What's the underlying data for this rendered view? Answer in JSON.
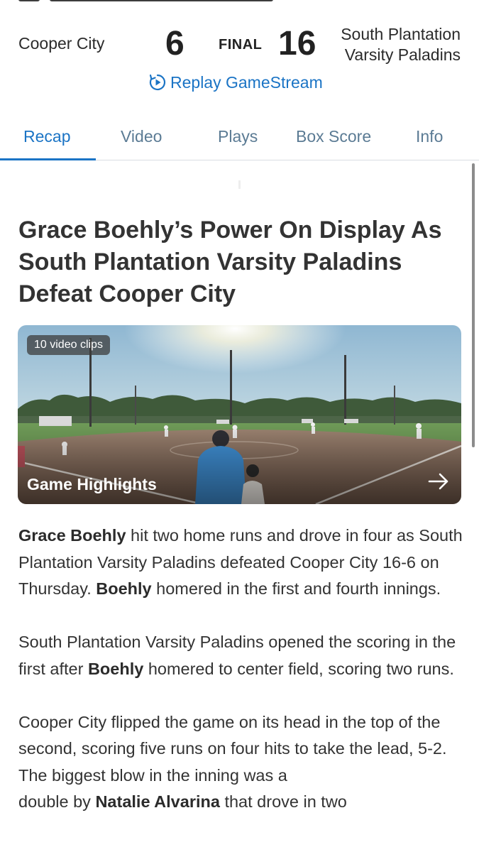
{
  "game": {
    "away_team": "Cooper City",
    "away_score": "6",
    "status": "FINAL",
    "home_score": "16",
    "home_team_line1": "South Plantation",
    "home_team_line2": "Varsity Paladins",
    "replay_label": "Replay GameStream"
  },
  "tabs": [
    {
      "label": "Recap",
      "active": true
    },
    {
      "label": "Video",
      "active": false
    },
    {
      "label": "Plays",
      "active": false
    },
    {
      "label": "Box Score",
      "active": false
    },
    {
      "label": "Info",
      "active": false
    }
  ],
  "headline": "Grace Boehly’s Power On Display As South Plantation Varsity Paladins Defeat Cooper City",
  "video": {
    "clips_count": "10 video clips",
    "title": "Game Highlights",
    "arrow_icon": "arrow-right-icon"
  },
  "article": {
    "p1": {
      "bold1": "Grace Boehly",
      "text1": " hit two home runs and drove in four as South Plantation Varsity Paladins defeated Cooper City 16-6 on Thursday. ",
      "bold2": "Boehly",
      "text2": " homered in the first and fourth innings."
    },
    "p2": {
      "text1": "South Plantation Varsity Paladins opened the scoring in the first after ",
      "bold1": "Boehly",
      "text2": " homered to center field, scoring two runs."
    },
    "p3": {
      "text1": "Cooper City flipped the game on its head in the top of the second, scoring five runs on four hits to take the lead, 5-2. The biggest blow in the inning was a",
      "text2": "double by ",
      "bold1": "Natalie Alvarina",
      "text3": " that drove in two"
    }
  },
  "colors": {
    "accent": "#1b74c5",
    "tab_inactive": "#5b7b94",
    "text": "#333333"
  }
}
